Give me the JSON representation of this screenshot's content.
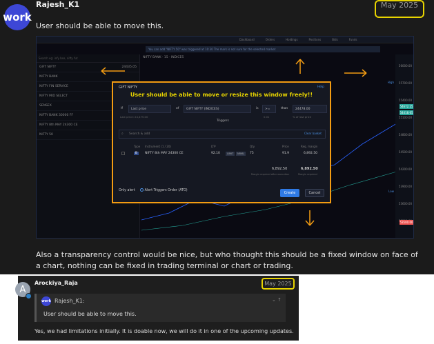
{
  "post1": {
    "avatar_text": "work",
    "username": "Rajesh_K1",
    "date": "May 2025",
    "text": "User should be able to move this.",
    "text2": "Also a transparency control would be nice, but who thought this should be a fixed window on face of a chart, nothing can be fixed in trading terminal or chart or trading."
  },
  "screenshot": {
    "toolbar_items": [
      "Dashboard",
      "Orders",
      "Holdings",
      "Positions",
      "Bids",
      "Funds"
    ],
    "notification": "You can add \"NIFTY 50\" was triggered at 10:30 The mark is not sure for the selected market",
    "watchlist_search": "Search eg: infy bse, nifty fut",
    "watchlist": [
      {
        "name": "GIFT NIFTY",
        "value": "24435.05"
      },
      {
        "name": "NIFTY BANK",
        "value": ""
      },
      {
        "name": "NIFTY FIN SERVICE",
        "value": ""
      },
      {
        "name": "NIFTY MID SELECT",
        "value": ""
      },
      {
        "name": "SENSEX",
        "value": ""
      },
      {
        "name": "NIFTY BANK 30000 FF",
        "value": ""
      },
      {
        "name": "NIFTY 8th MAY 24300 CE",
        "value": ""
      },
      {
        "name": "NIFTY 50",
        "value": ""
      }
    ],
    "chart_symbol": "NIFTY BANK · 15 · INDICES",
    "price_axis": [
      "56000.00",
      "55700.00",
      "55400.00",
      "55100.00",
      "54800.00",
      "54500.00",
      "54200.00",
      "53900.00",
      "53600.00",
      "53300.00"
    ],
    "price_labels": [
      {
        "label": "54672.25",
        "color": "#26a69a"
      },
      {
        "label": "54418.65",
        "color": "#26a69a"
      },
      {
        "label": "53500.00",
        "color": "#ef5350"
      }
    ],
    "high_label": "High",
    "low_label": "Low"
  },
  "dialog": {
    "title": "GIFT NIFTY",
    "help": "Help",
    "heading": "User should be able to move or resize this window freely!!",
    "if_label": "If",
    "field": "Last price",
    "of_label": "of",
    "instrument": "GIFT NIFTY (INDICES)",
    "is_label": "is",
    "operator": ">=",
    "than_label": "than",
    "target": "24478.00",
    "note_left": "Last price: 24,475.00",
    "note_mid": "0.01",
    "note_right": "% of last price",
    "triggers": "Triggers",
    "search_placeholder": "Search & add",
    "clear": "Clear basket",
    "columns": [
      "Type",
      "Instrument (1 / 20)",
      "LTP",
      "Qty",
      "Price",
      "Req. margin"
    ],
    "row": {
      "type": "B",
      "instrument": "NIFTY 8th MAY 24300 CE",
      "ltp": "92.10",
      "pill1": "LIMIT",
      "pill2": "NRML",
      "qty": "75",
      "price": "91.9",
      "margin": "6,892.50"
    },
    "total_left": "6,892.50",
    "total_right": "6,892.50",
    "sub_left": "Margin required after execution",
    "sub_right": "Margin required",
    "only_alert": "Only alert",
    "ato": "Alert Triggers Order (ATO)",
    "create": "Create",
    "cancel": "Cancel"
  },
  "post2": {
    "avatar_text": "A",
    "username": "Arockiya_Raja",
    "date": "May 2025",
    "quote_avatar": "work",
    "quote_user": "Rajesh_K1:",
    "quote_text": "User should be able to move this.",
    "reply": "Yes, we had limitations initially. It is doable now, we will do it in one of the upcoming updates."
  },
  "colors": {
    "accent_yellow": "#e8d400",
    "arrow_orange": "#f39c12",
    "brand_blue": "#3d47d6"
  }
}
